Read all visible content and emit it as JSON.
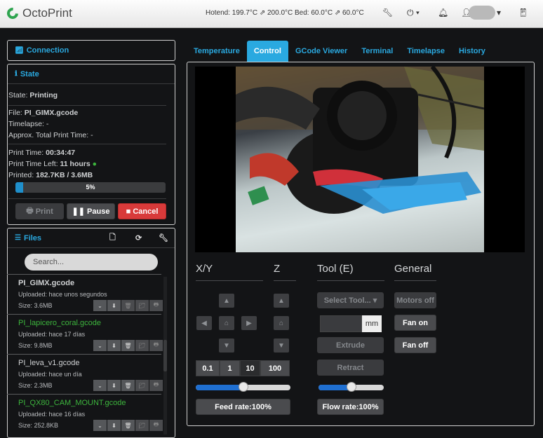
{
  "brand": "OctoPrint",
  "header": {
    "temps": "Hotend: 199.7°C ⇗ 200.0°C  Bed: 60.0°C ⇗ 60.0°C"
  },
  "connection": {
    "title": "Connection"
  },
  "state": {
    "title": "State",
    "state_label": "State: ",
    "state_value": "Printing",
    "file_label": "File: ",
    "file_value": "PI_GIMX.gcode",
    "timelapse": "Timelapse: -",
    "approx": "Approx. Total Print Time: -",
    "print_time_label": "Print Time: ",
    "print_time_value": "00:34:47",
    "time_left_label": "Print Time Left: ",
    "time_left_value": "11 hours",
    "printed_label": "Printed: ",
    "printed_value": "182.7KB / 3.6MB",
    "progress_text": "5%",
    "progress_value": 0.05
  },
  "buttons": {
    "print": "Print",
    "pause": "Pause",
    "cancel": "Cancel"
  },
  "files": {
    "title": "Files",
    "search_placeholder": "Search...",
    "items": [
      {
        "name": "PI_GIMX.gcode",
        "uploaded": "Uploaded: hace unos segundos",
        "size": "Size: 3.6MB",
        "color": "#cfd1d3"
      },
      {
        "name": "PI_lapicero_coral.gcode",
        "uploaded": "Uploaded: hace 17 días",
        "size": "Size: 9.8MB",
        "color": "#3db53d"
      },
      {
        "name": "PI_leva_v1.gcode",
        "uploaded": "Uploaded: hace un día",
        "size": "Size: 2.3MB",
        "color": "#cfd1d3"
      },
      {
        "name": "PI_QX80_CAM_MOUNT.gcode",
        "uploaded": "Uploaded: hace 16 días",
        "size": "Size: 252.8KB",
        "color": "#3db53d"
      }
    ]
  },
  "tabs": [
    "Temperature",
    "Control",
    "GCode Viewer",
    "Terminal",
    "Timelapse",
    "History"
  ],
  "control": {
    "xy": "X/Y",
    "z": "Z",
    "tool": "Tool (E)",
    "general": "General",
    "steps": [
      "0.1",
      "1",
      "10",
      "100"
    ],
    "feed_rate": "Feed rate:100%",
    "flow_rate": "Flow rate:100%",
    "feed_value": 0.5,
    "flow_value": 0.5,
    "select_tool": "Select Tool...",
    "mm": "mm",
    "extrude": "Extrude",
    "retract": "Retract",
    "motors_off": "Motors off",
    "fan_on": "Fan on",
    "fan_off": "Fan off"
  }
}
